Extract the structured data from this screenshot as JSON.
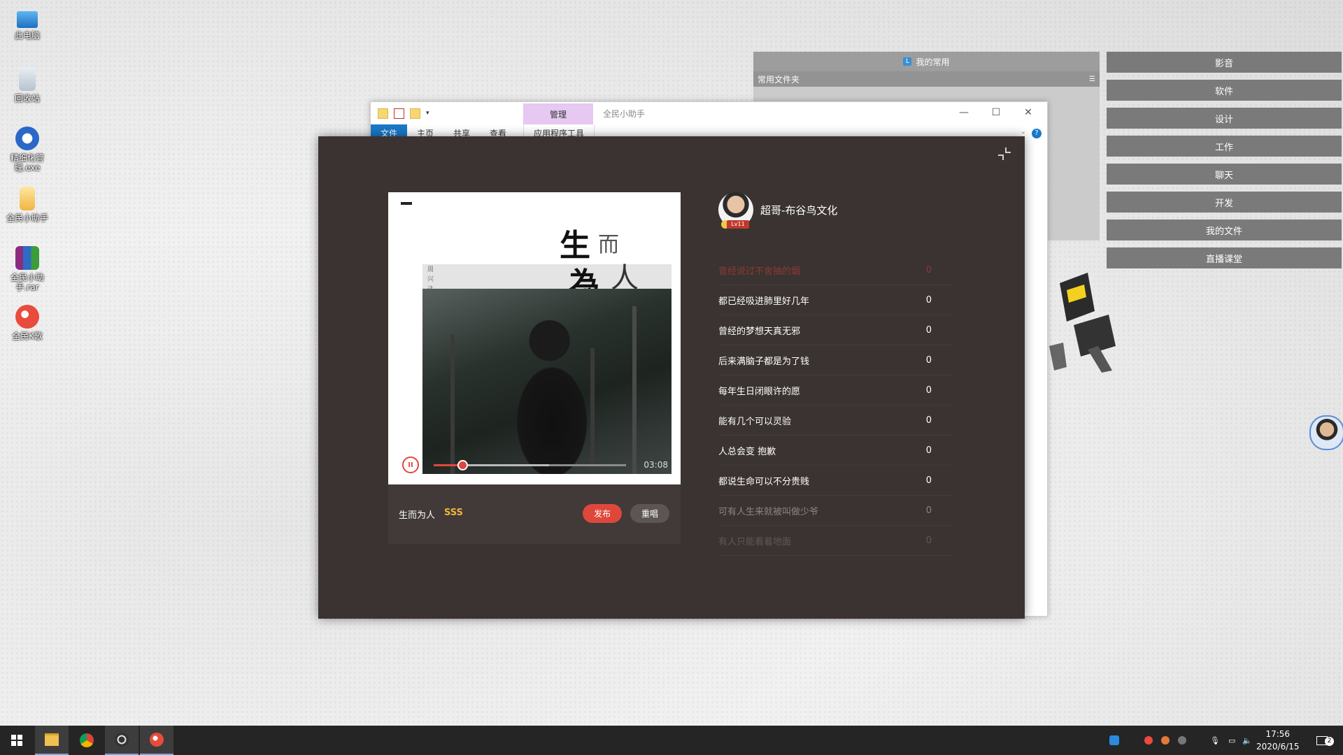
{
  "desktop": {
    "icons": [
      {
        "label": "此电脑",
        "icon": "computer-icon"
      },
      {
        "label": "回收站",
        "icon": "recycle-bin-icon"
      },
      {
        "label": "精细化管理.exe",
        "icon": "app-exe-icon"
      },
      {
        "label": "全民小助手",
        "icon": "folder-icon"
      },
      {
        "label": "全民小助手.rar",
        "icon": "rar-archive-icon"
      },
      {
        "label": "全民K歌",
        "icon": "karaoke-app-icon"
      }
    ]
  },
  "fence": {
    "title": "我的常用",
    "subtitle": "常用文件夹",
    "categories": [
      "影音",
      "软件",
      "设计",
      "工作",
      "聊天",
      "开发",
      "我的文件",
      "直播课堂"
    ]
  },
  "explorer": {
    "manage_label": "管理",
    "title": "全民小助手",
    "tabs": [
      "文件",
      "主页",
      "共享",
      "查看"
    ],
    "tools_tab": "应用程序工具",
    "minimize": "—",
    "maximize": "☐",
    "close": "✕",
    "help": "?"
  },
  "karaoke": {
    "cover": {
      "title_chars": [
        "生",
        "而",
        "為",
        "人"
      ],
      "side_text": "周兴达"
    },
    "player": {
      "pause_glyph": "II",
      "time": "03:08",
      "progress": 0.15
    },
    "song": {
      "name": "生而为人",
      "tag": "SSS",
      "publish_label": "发布",
      "resing_label": "重唱"
    },
    "profile": {
      "name": "超哥-布谷鸟文化",
      "level": "Lv11"
    },
    "lyrics": [
      {
        "text": "曾经说过不舍抽的烟",
        "count": "0",
        "state": "active"
      },
      {
        "text": "都已经吸进肺里好几年",
        "count": "0",
        "state": "normal"
      },
      {
        "text": "曾经的梦想天真无邪",
        "count": "0",
        "state": "normal"
      },
      {
        "text": "后来满脑子都是为了钱",
        "count": "0",
        "state": "normal"
      },
      {
        "text": "每年生日闭眼许的愿",
        "count": "0",
        "state": "normal"
      },
      {
        "text": "能有几个可以灵验",
        "count": "0",
        "state": "normal"
      },
      {
        "text": "人总会变 抱歉",
        "count": "0",
        "state": "normal"
      },
      {
        "text": "都说生命可以不分贵贱",
        "count": "0",
        "state": "normal"
      },
      {
        "text": "可有人生来就被叫做少爷",
        "count": "0",
        "state": "dim"
      },
      {
        "text": "有人只能看着地面",
        "count": "0",
        "state": "faint"
      }
    ]
  },
  "taskbar": {
    "clock_time": "17:56",
    "clock_date": "2020/6/15",
    "notifications": "2"
  },
  "colors": {
    "accent_red": "#e0473b",
    "tag_gold": "#f0b43a",
    "app_bg": "#3a3331"
  }
}
